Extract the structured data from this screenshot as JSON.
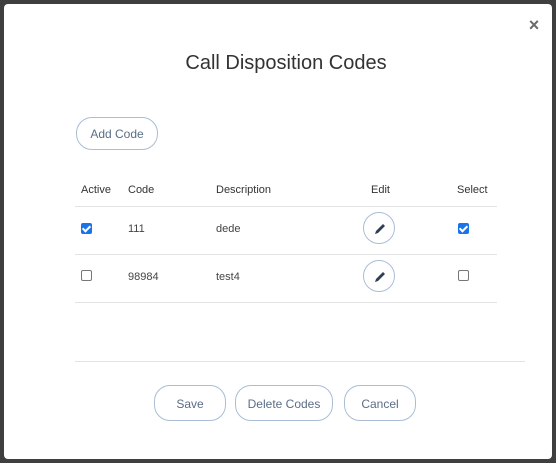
{
  "dialog": {
    "title": "Call Disposition Codes",
    "close_label": "×",
    "add_button": "Add Code"
  },
  "table": {
    "headers": {
      "active": "Active",
      "code": "Code",
      "description": "Description",
      "edit": "Edit",
      "select": "Select"
    },
    "rows": [
      {
        "active": true,
        "code": "111",
        "description": "dede",
        "selected": true
      },
      {
        "active": false,
        "code": "98984",
        "description": "test4",
        "selected": false
      }
    ]
  },
  "footer": {
    "save": "Save",
    "delete": "Delete Codes",
    "cancel": "Cancel"
  },
  "colors": {
    "accent": "#1a73e8",
    "button_border": "#a9bdd6",
    "button_text": "#5a6e86"
  },
  "icons": {
    "close": "close-icon",
    "edit": "pencil-icon",
    "checkbox": "checkbox"
  }
}
